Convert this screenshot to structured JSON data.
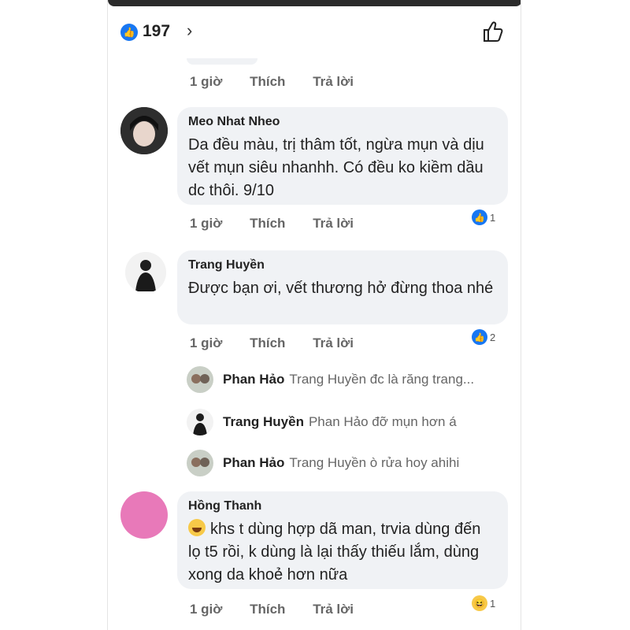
{
  "header": {
    "reaction_count": "197",
    "chevron": "›",
    "like_icon": "thumbs-up-outline"
  },
  "actions": {
    "time": "1 giờ",
    "like": "Thích",
    "reply": "Trả lời"
  },
  "comments": [
    {
      "author": "Meo Nhat Nheo",
      "text": "Da đều màu, trị thâm tốt, ngừa mụn và dịu vết mụn siêu nhanhh. Có đều ko kiềm dầu dc thôi. 9/10",
      "reactions": "1"
    },
    {
      "author": "Trang Huyền",
      "text": "Được bạn ơi, vết thương hở đừng thoa nhé",
      "reactions": "2"
    },
    {
      "author": "Hồng Thanh",
      "text": "khs t dùng hợp dã man, trvia dùng đến lọ t5 rồi, k dùng là lại thấy thiếu lắm, dùng xong da khoẻ hơn nữa",
      "reactions": "1"
    }
  ],
  "replies": [
    {
      "author": "Phan Hảo",
      "text": "Trang Huyền đc là răng trang..."
    },
    {
      "author": "Trang Huyền",
      "text": "Phan Hảo đỡ mụn hơn á"
    },
    {
      "author": "Phan Hảo",
      "text": "Trang Huyền ò rửa hoy ahihi"
    }
  ],
  "colors": {
    "accent": "#1877f2",
    "bubble": "#f0f2f5",
    "avatar_pink": "#e879b9"
  }
}
